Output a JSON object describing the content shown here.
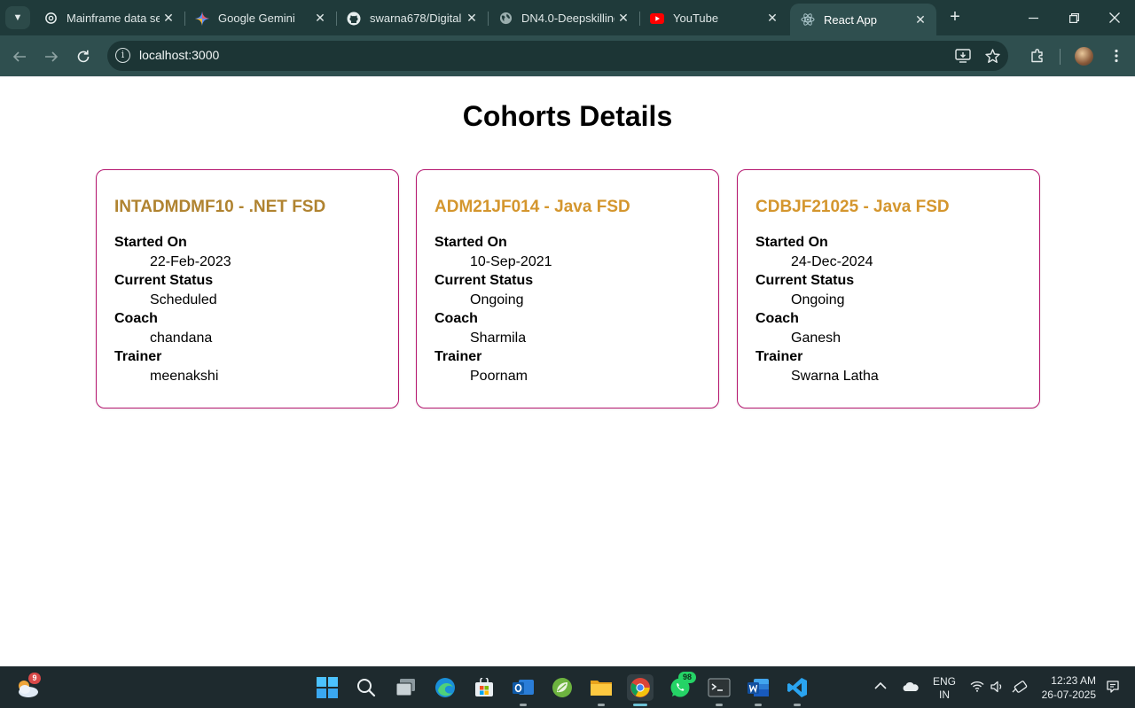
{
  "browser": {
    "tabs": [
      {
        "title": "Mainframe data se",
        "icon": "openai-icon"
      },
      {
        "title": "Google Gemini",
        "icon": "gemini-icon"
      },
      {
        "title": "swarna678/Digital",
        "icon": "github-icon"
      },
      {
        "title": "DN4.0-Deepskilling",
        "icon": "globe-icon"
      },
      {
        "title": "YouTube",
        "icon": "youtube-icon"
      },
      {
        "title": "React App",
        "icon": "react-icon",
        "active": true
      }
    ],
    "close_glyph": "✕",
    "new_tab_glyph": "+",
    "url": "localhost:3000"
  },
  "page": {
    "title": "Cohorts Details",
    "cohorts": [
      {
        "name": "INTADMDMF10 - .NET FSD",
        "name_color": "#b08330",
        "labels": {
          "started": "Started On",
          "status": "Current Status",
          "coach": "Coach",
          "trainer": "Trainer"
        },
        "started_on": "22-Feb-2023",
        "current_status": "Scheduled",
        "coach": "chandana",
        "trainer": "meenakshi"
      },
      {
        "name": "ADM21JF014 - Java FSD",
        "name_color": "#d4962e",
        "labels": {
          "started": "Started On",
          "status": "Current Status",
          "coach": "Coach",
          "trainer": "Trainer"
        },
        "started_on": "10-Sep-2021",
        "current_status": "Ongoing",
        "coach": "Sharmila",
        "trainer": "Poornam"
      },
      {
        "name": "CDBJF21025 - Java FSD",
        "name_color": "#d4962e",
        "labels": {
          "started": "Started On",
          "status": "Current Status",
          "coach": "Coach",
          "trainer": "Trainer"
        },
        "started_on": "24-Dec-2024",
        "current_status": "Ongoing",
        "coach": "Ganesh",
        "trainer": "Swarna Latha"
      }
    ],
    "card_border_color": "#b5166f"
  },
  "taskbar": {
    "weather_badge": "9",
    "whatsapp_badge": "98",
    "lang_line1": "ENG",
    "lang_line2": "IN",
    "time": "12:23 AM",
    "date": "26-07-2025"
  }
}
